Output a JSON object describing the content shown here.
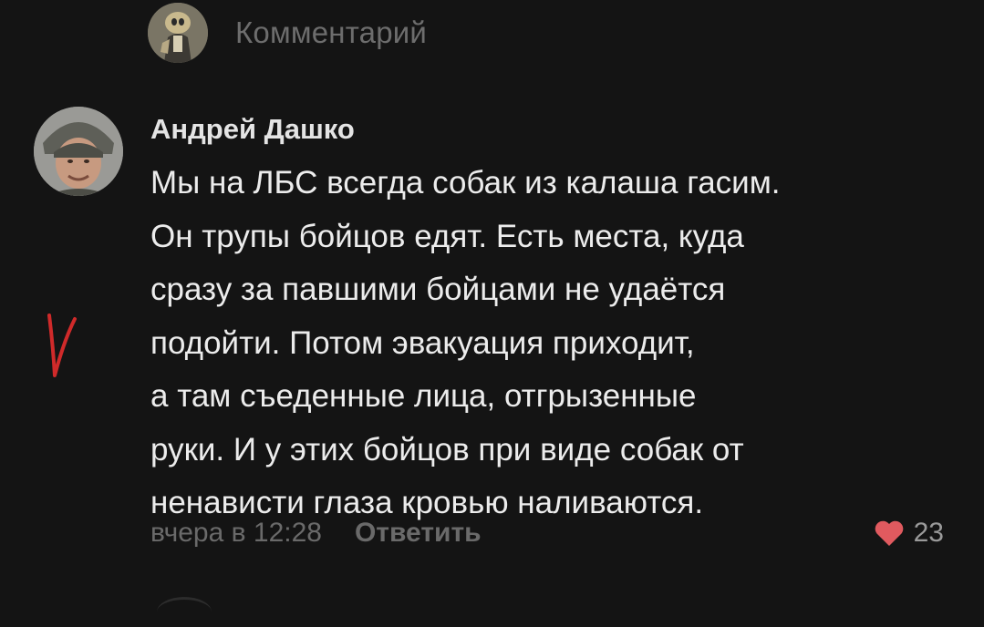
{
  "top_bar": {
    "label": "Комментарий",
    "avatar_icon": "cartoon-character-avatar"
  },
  "comment": {
    "author": "Андрей Дашко",
    "avatar_icon": "user-avatar-man-in-helmet",
    "lines": [
      "Мы на ЛБС всегда собак из калаша гасим.",
      "Он трупы бойцов едят. Есть места, куда",
      "сразу за павшими бойцами не удаётся",
      "подойти. Потом эвакуация приходит,",
      "а там съеденные лица, отгрызенные",
      "руки. И у этих бойцов при виде собак от",
      "ненависти глаза кровью наливаются."
    ],
    "timestamp": "вчера в 12:28",
    "reply_label": "Ответить",
    "likes": "23",
    "like_icon": "heart-icon",
    "like_color": "#e05a5f"
  },
  "annotation": {
    "icon": "red-checkmark-annotation",
    "color": "#d02a2a"
  }
}
